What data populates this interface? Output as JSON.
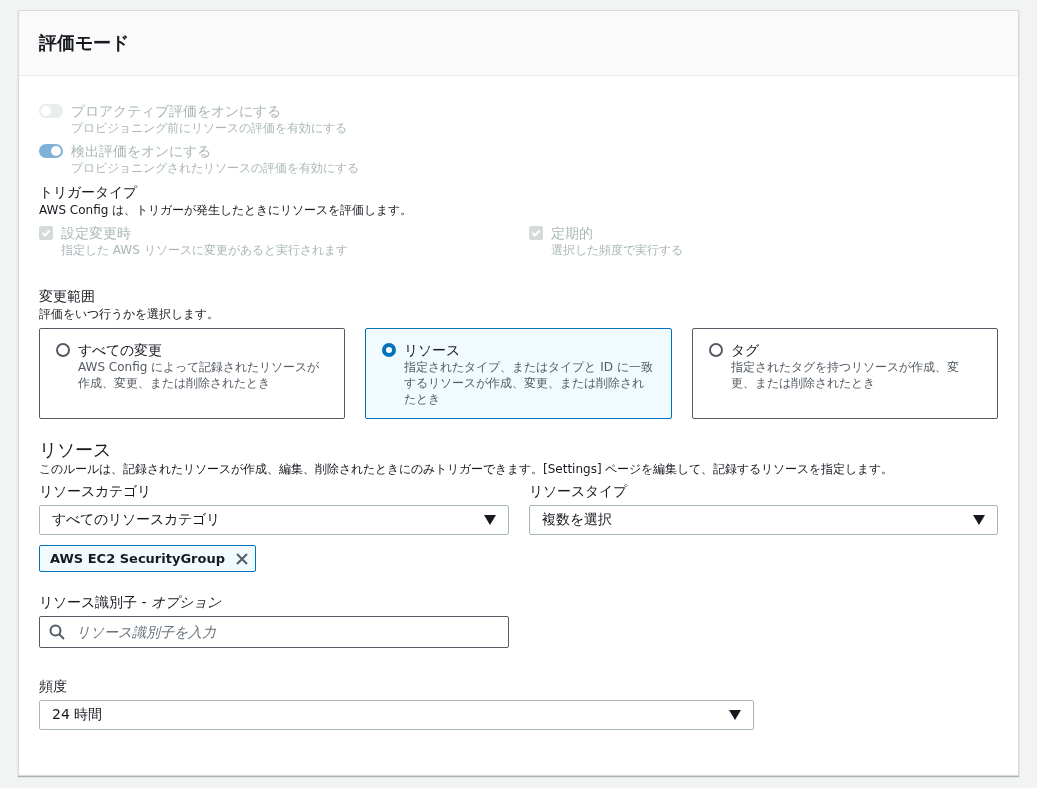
{
  "panel": {
    "title": "評価モード"
  },
  "toggles": [
    {
      "label": "プロアクティブ評価をオンにする",
      "description": "プロビジョニング前にリソースの評価を有効にする",
      "on": false,
      "disabled": true
    },
    {
      "label": "検出評価をオンにする",
      "description": "プロビジョニングされたリソースの評価を有効にする",
      "on": true,
      "disabled": true
    }
  ],
  "trigger_type": {
    "label": "トリガータイプ",
    "description": "AWS Config は、トリガーが発生したときにリソースを評価します。",
    "options": [
      {
        "label": "設定変更時",
        "description": "指定した AWS リソースに変更があると実行されます",
        "checked": true,
        "disabled": true
      },
      {
        "label": "定期的",
        "description": "選択した頻度で実行する",
        "checked": true,
        "disabled": true
      }
    ]
  },
  "scope": {
    "label": "変更範囲",
    "description": "評価をいつ行うかを選択します。",
    "options": [
      {
        "label": "すべての変更",
        "description": "AWS Config によって記録されたリソースが作成、変更、または削除されたとき",
        "selected": false
      },
      {
        "label": "リソース",
        "description": "指定されたタイプ、またはタイプと ID に一致するリソースが作成、変更、または削除されたとき",
        "selected": true
      },
      {
        "label": "タグ",
        "description": "指定されたタグを持つリソースが作成、変更、または削除されたとき",
        "selected": false
      }
    ]
  },
  "resources": {
    "heading": "リソース",
    "description": "このルールは、記録されたリソースが作成、編集、削除されたときにのみトリガーできます。[Settings] ページを編集して、記録するリソースを指定します。",
    "category": {
      "label": "リソースカテゴリ",
      "value": "すべてのリソースカテゴリ"
    },
    "type": {
      "label": "リソースタイプ",
      "value": "複数を選択"
    },
    "tokens": [
      "AWS EC2 SecurityGroup"
    ],
    "identifier": {
      "label": "リソース識別子 - *オプション*",
      "placeholder": "リソース識別子を入力"
    }
  },
  "frequency": {
    "label": "頻度",
    "value": "24 時間"
  }
}
